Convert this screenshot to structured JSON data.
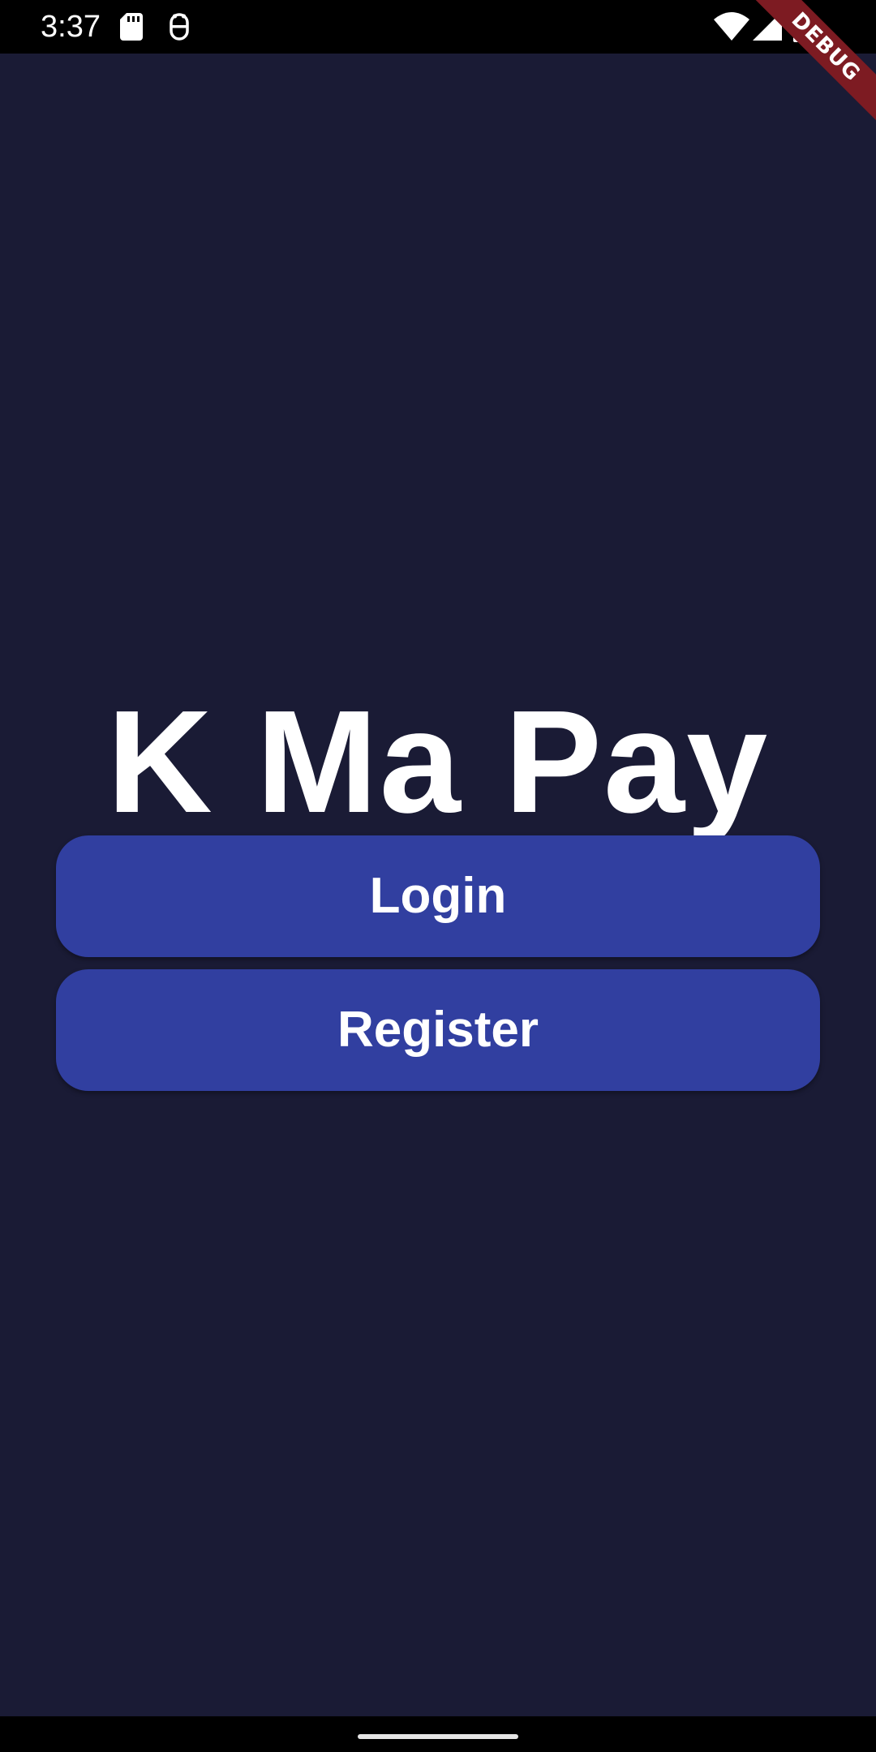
{
  "status_bar": {
    "time": "3:37",
    "icons": [
      "sd-card-icon",
      "debug-bug-icon",
      "wifi-icon",
      "cell-signal-icon",
      "battery-icon"
    ]
  },
  "debug_banner": {
    "label": "DEBUG",
    "color": "#7d1b22"
  },
  "main": {
    "title": "K Ma Pay",
    "login_label": "Login",
    "register_label": "Register"
  },
  "colors": {
    "background": "#1a1b35",
    "button": "#313fa0",
    "text": "#ffffff"
  }
}
